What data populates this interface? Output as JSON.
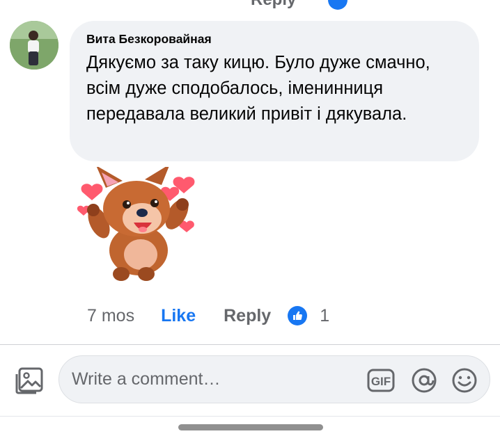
{
  "top_fragment": {
    "label": "Reply"
  },
  "comment": {
    "author": "Вита Безкоровайная",
    "text": "Дякуємо за таку кицю. Було дуже смачно, всім дуже сподобалось, іменинниця передавала великий привіт і дякувала.",
    "sticker": "puppy-hearts-sticker"
  },
  "actions": {
    "time": "7 mos",
    "like_label": "Like",
    "reply_label": "Reply",
    "reaction_count": "1"
  },
  "composer": {
    "placeholder": "Write a comment…",
    "icons": [
      "photo-icon",
      "gif-icon",
      "mention-icon",
      "emoji-icon"
    ]
  },
  "colors": {
    "accent": "#1877f2",
    "bubble": "#f0f2f5",
    "secondary_text": "#65676b"
  }
}
